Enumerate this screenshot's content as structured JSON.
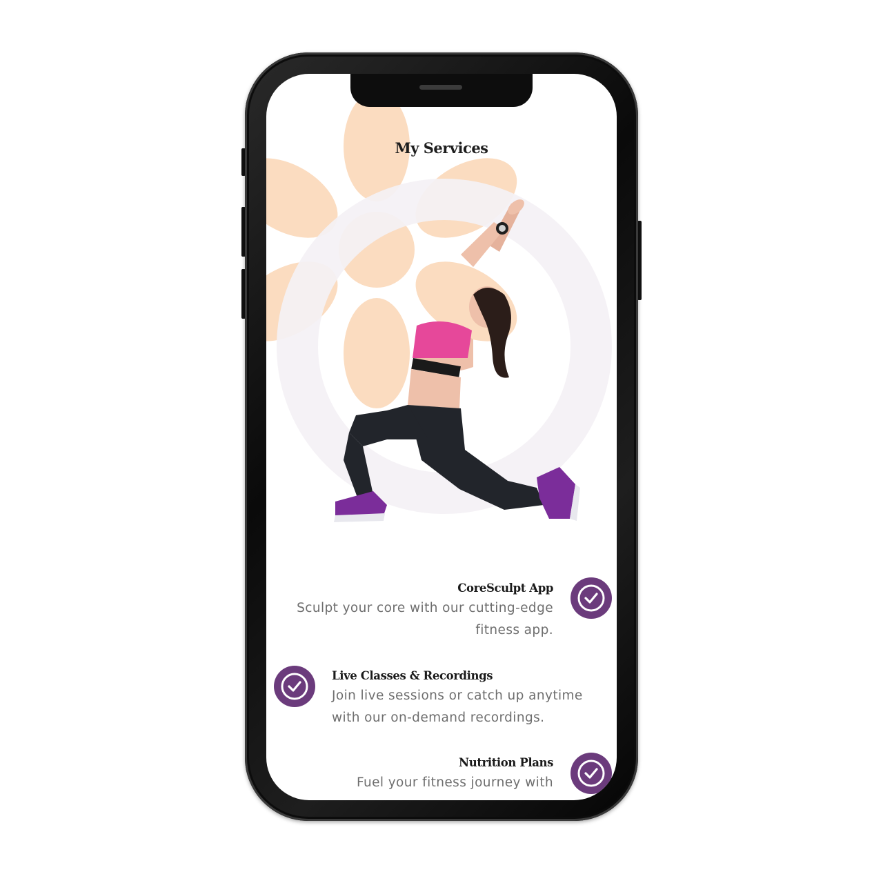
{
  "page": {
    "heading": "My Services"
  },
  "services": [
    {
      "title": "CoreSculpt App",
      "description_lines": [
        "Sculpt your core with our cutting-edge",
        "fitness app."
      ]
    },
    {
      "title": "Live Classes & Recordings",
      "description_lines": [
        "Join live sessions or catch up anytime",
        "with our on-demand recordings."
      ]
    },
    {
      "title": "Nutrition Plans",
      "description_lines": [
        "Fuel your fitness journey with"
      ]
    }
  ],
  "icons": {
    "check": "check-circle-icon",
    "decoration": "flower-shape"
  },
  "colors": {
    "accent": "#6b3b7c",
    "flower": "#fbdcc0",
    "ring": "#f3eff4",
    "heading": "#1d1d1d",
    "body_text": "#6e6e6e",
    "phone_frame": "#0a0a0a"
  }
}
